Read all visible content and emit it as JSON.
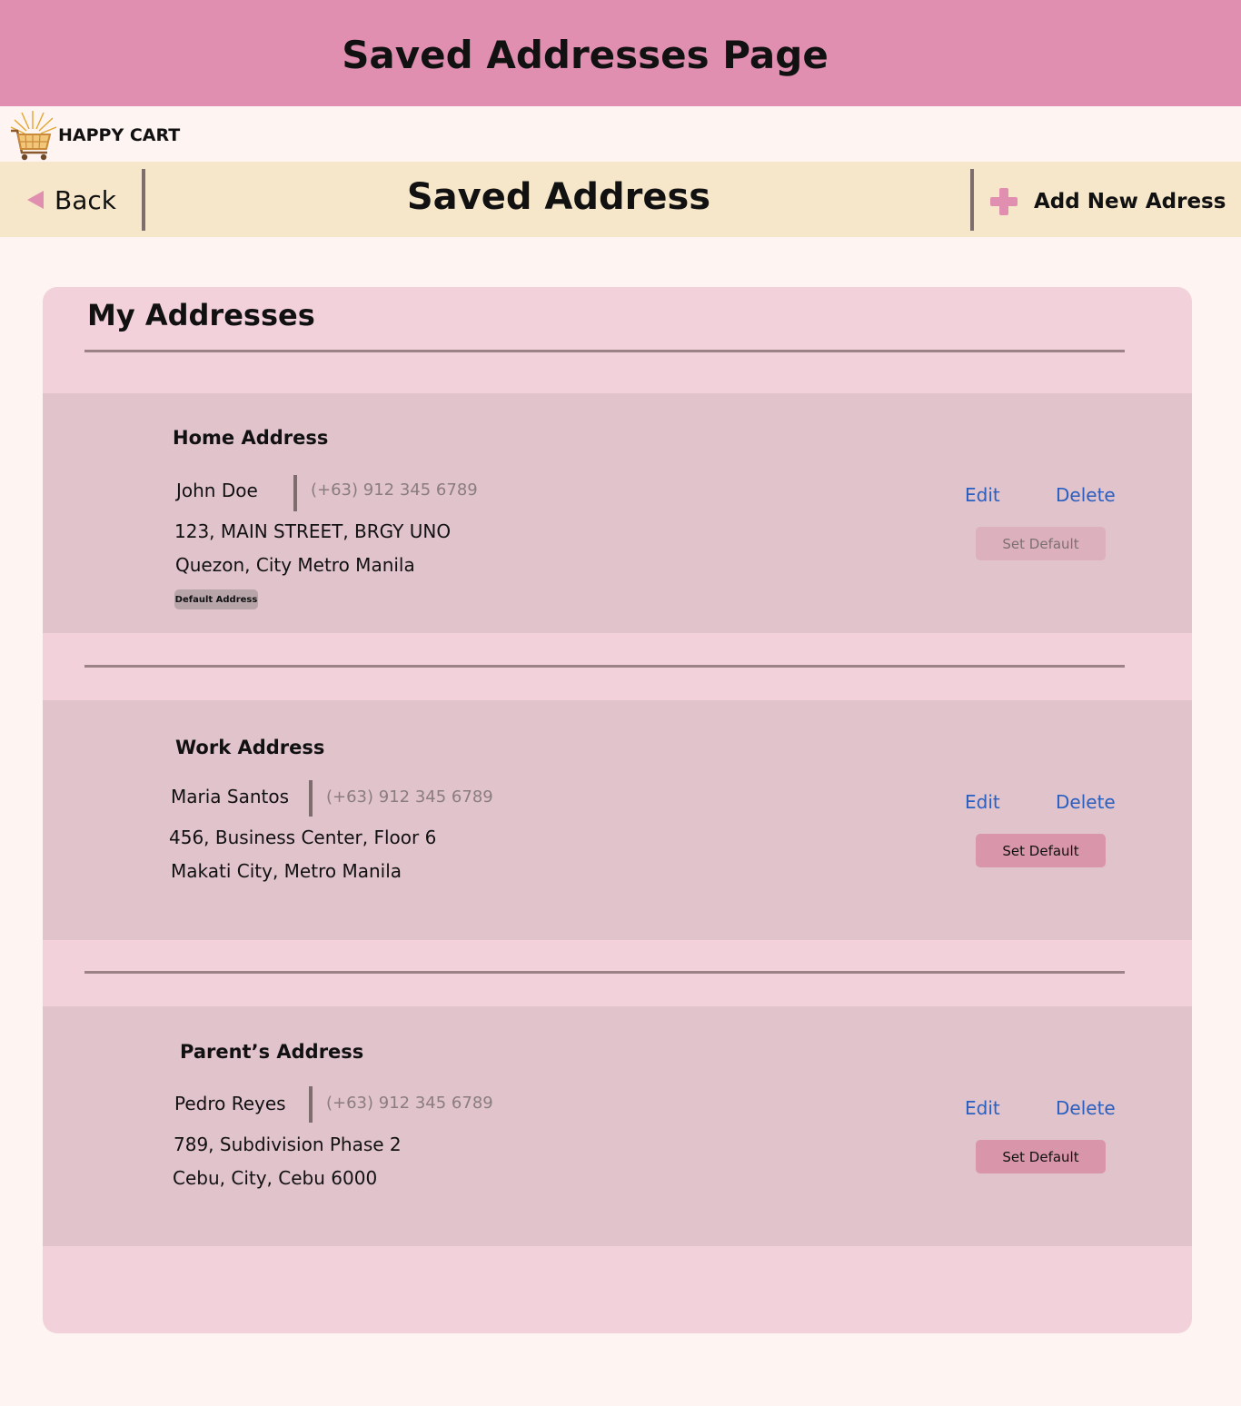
{
  "banner": {
    "title": "Saved Addresses Page"
  },
  "brand": {
    "name": "HAPPY CART",
    "logo_icon": "shopping-cart-icon"
  },
  "navbar": {
    "back_label": "Back",
    "title": "Saved Address",
    "add_label": "Add New Adress"
  },
  "colors": {
    "banner": "#e08fb0",
    "navbar": "#f6e6ca",
    "card": "#f2d1db",
    "address_block": "#e1c3cc",
    "link": "#2a5fbf",
    "set_default": "#d995a9"
  },
  "card": {
    "title": "My Addresses",
    "addresses": [
      {
        "label": "Home Address",
        "name": "John Doe",
        "phone": "(+63) 912 345 6789",
        "line1": "123, MAIN STREET, BRGY UNO",
        "line2": "Quezon, City Metro Manila",
        "badge": "Default Address",
        "edit": "Edit",
        "delete": "Delete",
        "set_default": "Set Default"
      },
      {
        "label": "Work Address",
        "name": "Maria Santos",
        "phone": "(+63) 912 345 6789",
        "line1": "456, Business Center, Floor 6",
        "line2": "Makati City, Metro Manila",
        "edit": "Edit",
        "delete": "Delete",
        "set_default": "Set Default"
      },
      {
        "label": "Parent’s Address",
        "name": "Pedro Reyes",
        "phone": "(+63) 912 345 6789",
        "line1": "789, Subdivision Phase 2",
        "line2": "Cebu, City, Cebu 6000",
        "edit": "Edit",
        "delete": "Delete",
        "set_default": "Set Default"
      }
    ]
  }
}
